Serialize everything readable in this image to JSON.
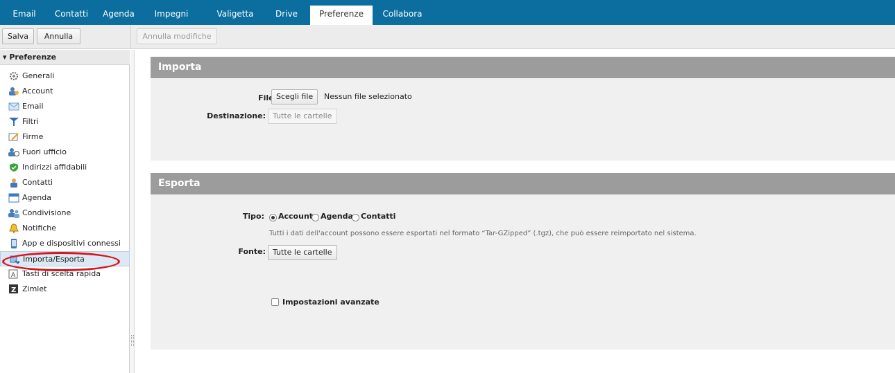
{
  "tabs": [
    "Email",
    "Contatti",
    "Agenda",
    "Impegni",
    "Valigetta",
    "Drive",
    "Preferenze",
    "Collabora"
  ],
  "active_tab": "Preferenze",
  "toolbar": {
    "save_label": "Salva",
    "cancel_label": "Annulla",
    "undo_label": "Annulla modifiche"
  },
  "sidebar": {
    "header": "Preferenze",
    "items": [
      {
        "label": "Generali",
        "icon": "gear-icon"
      },
      {
        "label": "Account",
        "icon": "account-icon"
      },
      {
        "label": "Email",
        "icon": "mail-icon"
      },
      {
        "label": "Filtri",
        "icon": "filter-icon"
      },
      {
        "label": "Firme",
        "icon": "signature-icon"
      },
      {
        "label": "Fuori ufficio",
        "icon": "out-of-office-icon"
      },
      {
        "label": "Indirizzi affidabili",
        "icon": "shield-icon"
      },
      {
        "label": "Contatti",
        "icon": "contact-icon"
      },
      {
        "label": "Agenda",
        "icon": "calendar-icon"
      },
      {
        "label": "Condivisione",
        "icon": "share-icon"
      },
      {
        "label": "Notifiche",
        "icon": "bell-icon"
      },
      {
        "label": "App e dispositivi connessi",
        "icon": "device-icon"
      },
      {
        "label": "Importa/Esporta",
        "icon": "import-export-icon"
      },
      {
        "label": "Tasti di scelta rapida",
        "icon": "keyboard-icon"
      },
      {
        "label": "Zimlet",
        "icon": "zimlet-icon"
      }
    ],
    "selected": "Importa/Esporta"
  },
  "import": {
    "title": "Importa",
    "file_label": "File:",
    "file_button": "Scegli file",
    "file_status": "Nessun file selezionato",
    "destination_label": "Destinazione:",
    "destination_button": "Tutte le cartelle"
  },
  "export": {
    "title": "Esporta",
    "type_label": "Tipo:",
    "types": [
      "Account",
      "Agenda",
      "Contatti"
    ],
    "selected_type": "Account",
    "description": "Tutti i dati dell'account possono essere esportati nel formato “Tar-GZipped” (.tgz), che può essere reimportato nel sistema.",
    "source_label": "Fonte:",
    "source_button": "Tutte le cartelle",
    "advanced_label": "Impostazioni avanzate"
  }
}
